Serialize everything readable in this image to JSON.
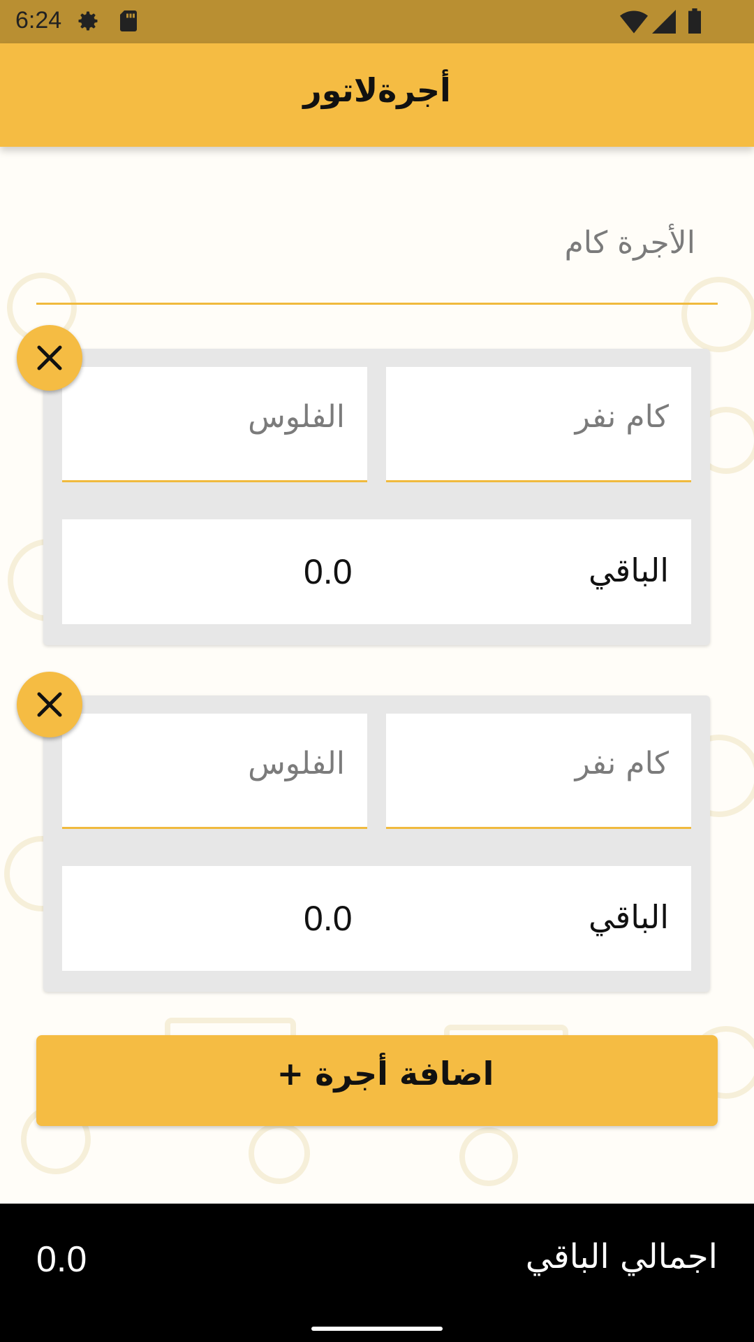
{
  "status_bar": {
    "time": "6:24"
  },
  "app_bar": {
    "title": "أجرةلاتور"
  },
  "fare_input": {
    "placeholder": "الأجرة كام"
  },
  "fares": [
    {
      "persons_placeholder": "كام نفر",
      "money_placeholder": "الفلوس",
      "remaining_label": "الباقي",
      "remaining_value": "0.0"
    },
    {
      "persons_placeholder": "كام نفر",
      "money_placeholder": "الفلوس",
      "remaining_label": "الباقي",
      "remaining_value": "0.0"
    }
  ],
  "add_button": {
    "label": "اضافة أجرة",
    "icon": "+"
  },
  "bottom_bar": {
    "total_label": "اجمالي الباقي",
    "total_value": "0.0"
  },
  "colors": {
    "accent": "#f5bc43",
    "status_bar": "#b98f32",
    "card": "#e7e7e7",
    "bottom_bar": "#000000"
  }
}
